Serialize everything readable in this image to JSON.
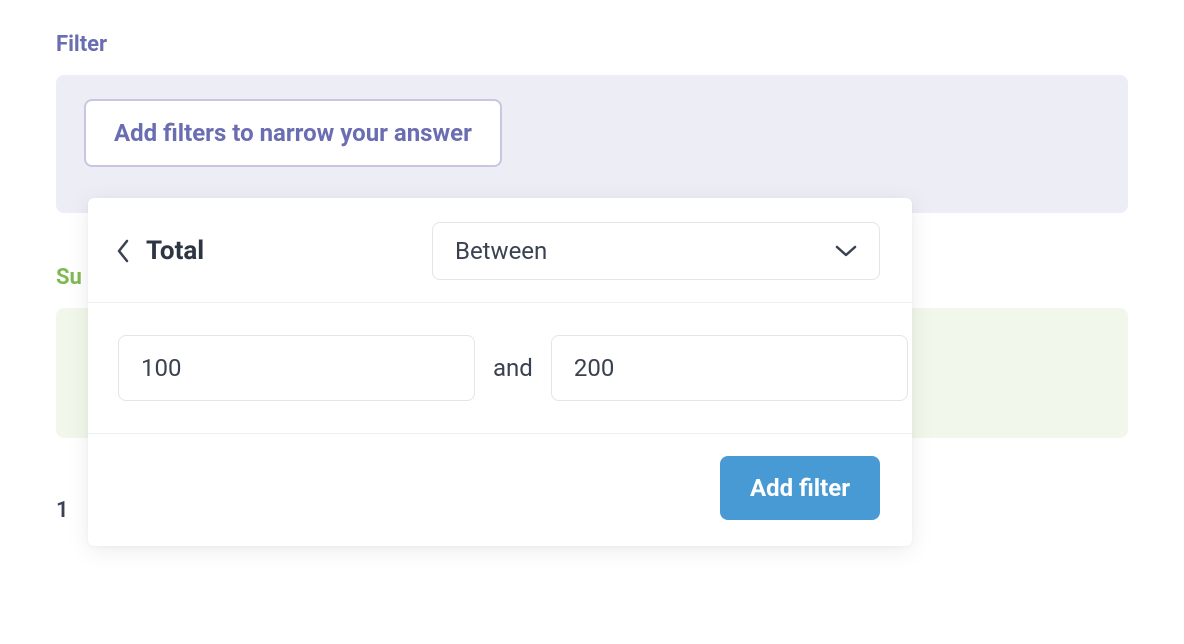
{
  "filter": {
    "section_label": "Filter",
    "pill_label": "Add filters to narrow your answer"
  },
  "summarize": {
    "section_label_fragment": "Su",
    "value_fragment": "1"
  },
  "popover": {
    "title": "Total",
    "operator": "Between",
    "value_from": "100",
    "conjunction": "and",
    "value_to": "200",
    "submit_label": "Add filter"
  }
}
